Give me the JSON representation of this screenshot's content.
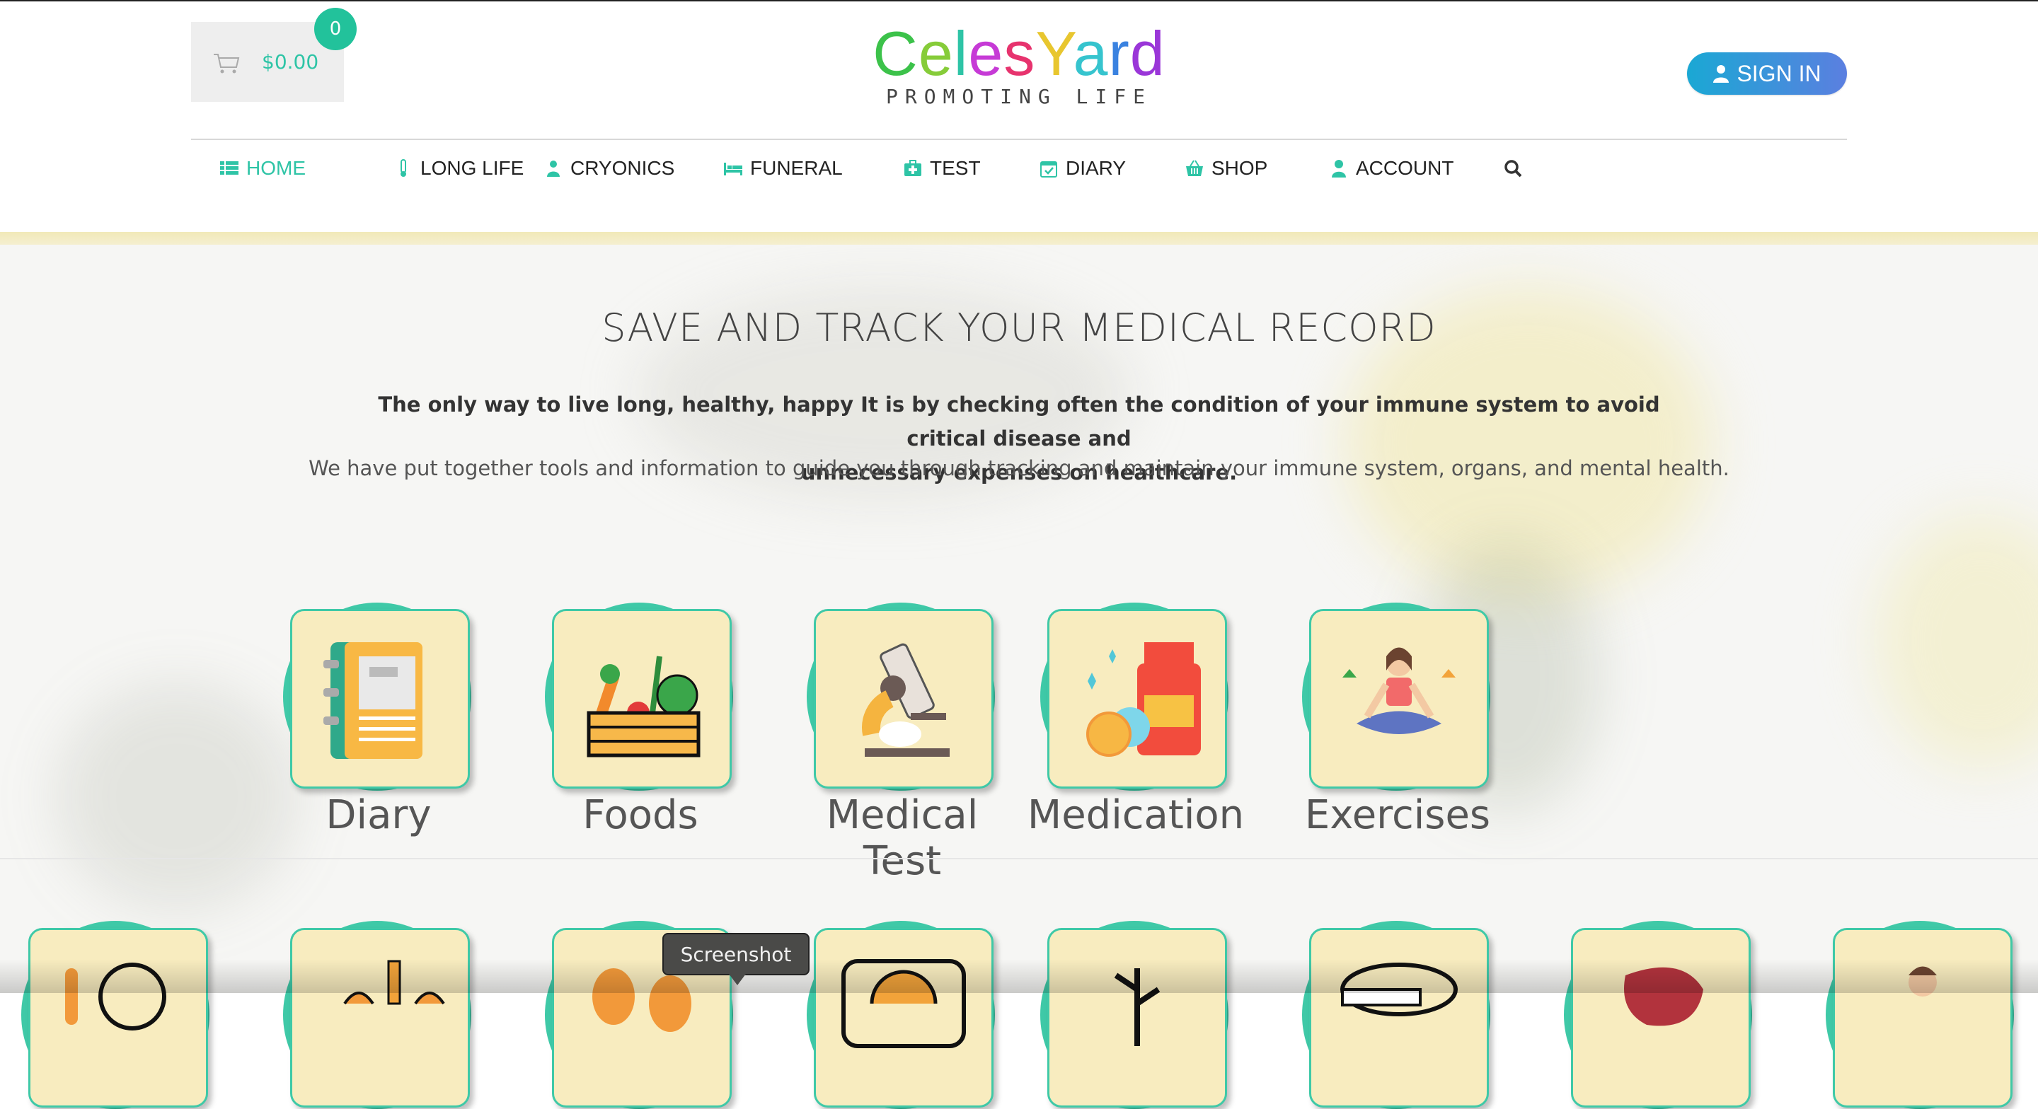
{
  "cart": {
    "total": "$0.00",
    "count": "0",
    "icon": "cart-icon"
  },
  "logo": {
    "letters": [
      {
        "ch": "C",
        "color": "#3cc24a"
      },
      {
        "ch": "e",
        "color": "#86cc39"
      },
      {
        "ch": "l",
        "color": "#2ec4a6"
      },
      {
        "ch": "e",
        "color": "#c63ad6"
      },
      {
        "ch": "s",
        "color": "#e7336e"
      },
      {
        "ch": "Y",
        "color": "#e8c62f"
      },
      {
        "ch": "a",
        "color": "#36c4ce"
      },
      {
        "ch": "r",
        "color": "#3a82e0"
      },
      {
        "ch": "d",
        "color": "#9a36d8"
      }
    ],
    "tagline": "PROMOTING LIFE"
  },
  "signin": {
    "label": "SIGN IN",
    "icon": "user-icon"
  },
  "nav": {
    "items": [
      {
        "label": "HOME",
        "icon": "list-icon",
        "active": true
      },
      {
        "label": "LONG LIFE",
        "icon": "thermometer-icon"
      },
      {
        "label": "CRYONICS",
        "icon": "doctor-icon"
      },
      {
        "label": "FUNERAL",
        "icon": "bed-icon"
      },
      {
        "label": "TEST",
        "icon": "medkit-icon"
      },
      {
        "label": "DIARY",
        "icon": "calendar-check-icon"
      },
      {
        "label": "SHOP",
        "icon": "basket-icon"
      },
      {
        "label": "ACCOUNT",
        "icon": "user-icon"
      }
    ],
    "search_icon": "search-icon"
  },
  "hero": {
    "title": "SAVE AND TRACK YOUR MEDICAL RECORD",
    "bold_line1": "The only way to live long, healthy, happy It is by checking often the condition of your immune system to avoid critical disease and",
    "bold_line2": "unnecessary expenses on healthcare.",
    "sub": "We have put together tools and information to guide you through tracking and maintain your immune system, organs, and mental health."
  },
  "tiles": [
    {
      "label": "Diary",
      "icon": "notebook-icon"
    },
    {
      "label": "Foods",
      "icon": "vegetable-crate-icon"
    },
    {
      "label": "Medical Test",
      "icon": "microscope-icon"
    },
    {
      "label": "Medication",
      "icon": "pill-bottle-icon"
    },
    {
      "label": "Exercises",
      "icon": "yoga-icon"
    }
  ],
  "lower_tiles": [
    {
      "icon": "face-icon"
    },
    {
      "icon": "lungs-icon"
    },
    {
      "icon": "kidney-icon"
    },
    {
      "icon": "gauge-icon"
    },
    {
      "icon": "plant-icon"
    },
    {
      "icon": "measuring-tape-icon"
    },
    {
      "icon": "liver-icon"
    },
    {
      "icon": "person-icon"
    }
  ],
  "tooltip": "Screenshot",
  "colors": {
    "accent": "#2ec4a6",
    "tile_bg": "#f8ecbf",
    "tile_border": "#3fc9a7"
  }
}
